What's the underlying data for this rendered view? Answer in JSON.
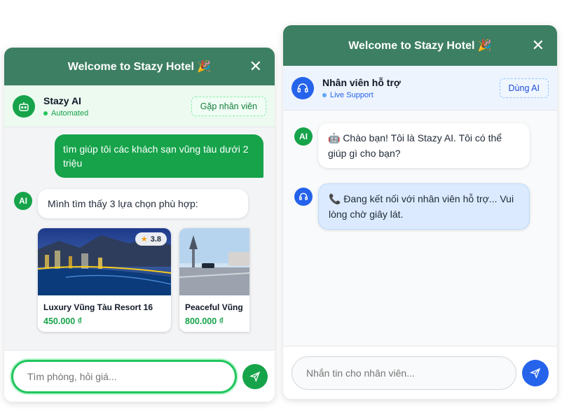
{
  "left": {
    "header": {
      "title": "Welcome to Stazy Hotel 🎉",
      "close": "✕"
    },
    "agent": {
      "name": "Stazy AI",
      "status": "Automated",
      "switch_label": "Gặp nhân viên"
    },
    "messages": {
      "user_text": "tìm giúp tôi các khách sạn vũng tàu dưới 2 triệu",
      "bot_avatar": "AI",
      "bot_text": "Mình tìm thấy 3 lựa chọn phù hợp:"
    },
    "hotels": [
      {
        "name": "Luxury Vũng Tàu Resort 16",
        "price": "450.000 ₫",
        "rating": "3.8"
      },
      {
        "name": "Peaceful Vũng Tàu",
        "price": "800.000 ₫"
      }
    ],
    "input": {
      "placeholder": "Tìm phòng, hỏi giá..."
    }
  },
  "right": {
    "header": {
      "title": "Welcome to Stazy Hotel 🎉",
      "close": "✕"
    },
    "agent": {
      "name": "Nhân viên hỗ trợ",
      "status": "Live Support",
      "switch_label": "Dùng AI"
    },
    "messages": {
      "bot_avatar": "AI",
      "bot_text": "🤖 Chào bạn! Tôi là Stazy AI. Tôi có thể giúp gì cho bạn?",
      "system_text": "📞 Đang kết nối với nhân viên hỗ trợ... Vui lòng chờ giây lát."
    },
    "input": {
      "placeholder": "Nhắn tin cho nhân viên..."
    }
  },
  "colors": {
    "header": "#3d7f63",
    "accent_green": "#16a34a",
    "accent_blue": "#2563eb"
  }
}
